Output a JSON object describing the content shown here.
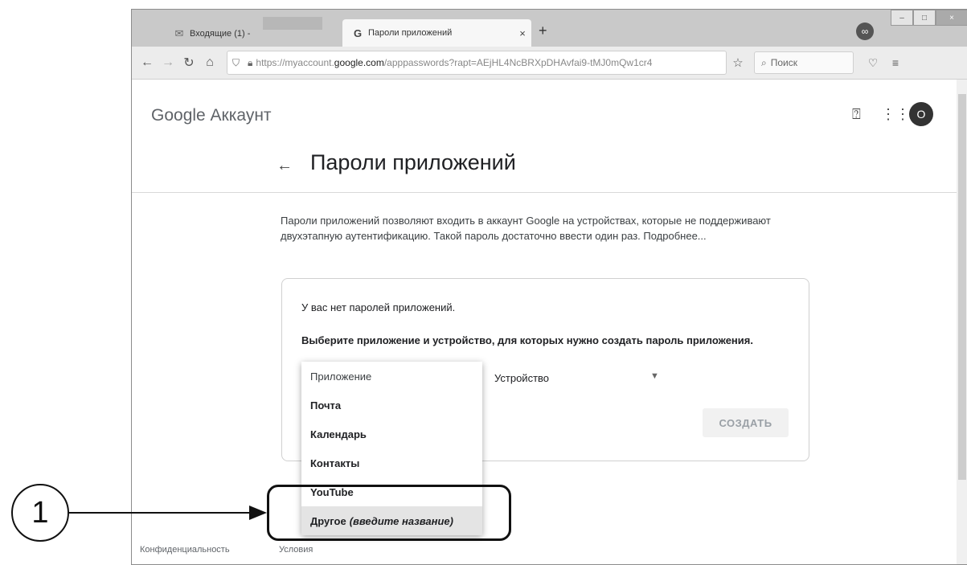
{
  "browser": {
    "tabs": [
      {
        "icon": "mail-icon",
        "label": "Входящие (1) -"
      },
      {
        "icon": "google-g-icon",
        "label": "Пароли приложений"
      }
    ],
    "url_prefix": "https://myaccount.",
    "url_domain": "google.com",
    "url_rest": "/apppasswords?rapt=AEjHL4NcBRXpDHAvfai9-tMJ0mQw1cr4",
    "search_placeholder": "Поиск"
  },
  "header": {
    "brand": "Google Аккаунт",
    "avatar_letter": "О"
  },
  "page": {
    "title": "Пароли приложений",
    "description": "Пароли приложений позволяют входить в аккаунт Google на устройствах, которые не поддерживают двухэтапную аутентификацию. Такой пароль достаточно ввести один раз. Подробнее...",
    "empty_message": "У вас нет паролей приложений.",
    "instruction": "Выберите приложение и устройство, для которых нужно создать пароль приложения.",
    "device_label": "Устройство",
    "create_label": "СОЗДАТЬ"
  },
  "dropdown": {
    "placeholder": "Приложение",
    "options": [
      "Почта",
      "Календарь",
      "Контакты",
      "YouTube"
    ],
    "other_label": "Другое",
    "other_hint": "(введите название)"
  },
  "footer": {
    "privacy": "Конфиденциальность",
    "terms": "Условия"
  },
  "callout": {
    "number": "1"
  }
}
